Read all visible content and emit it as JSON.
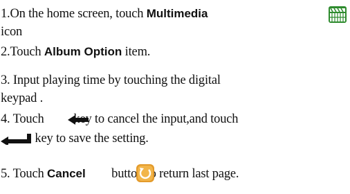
{
  "steps": {
    "s1": {
      "a": "1.On the home screen, touch ",
      "b": "Multimedia",
      "c": "icon"
    },
    "s2": {
      "a": "2.Touch ",
      "b": "Album Option",
      "c": " item."
    },
    "s3": {
      "a": "3. Input playing time by touching the digital",
      "c": "keypad ."
    },
    "s4": {
      "a": "4. Touch ",
      "b": " key to cancel the input,and touch",
      "c": " key to save the setting."
    },
    "s5": {
      "a": "5. Touch ",
      "b": "Cancel",
      "c": " button to return last page."
    }
  },
  "icons": {
    "multimedia": "clapperboard-icon",
    "backspace": "backspace-arrow-icon",
    "enter": "enter-arrow-icon",
    "cancel": "return-icon"
  },
  "colors": {
    "multimedia_green": "#2e8b2e",
    "cancel_orange": "#e39a2a",
    "text": "#111111"
  }
}
